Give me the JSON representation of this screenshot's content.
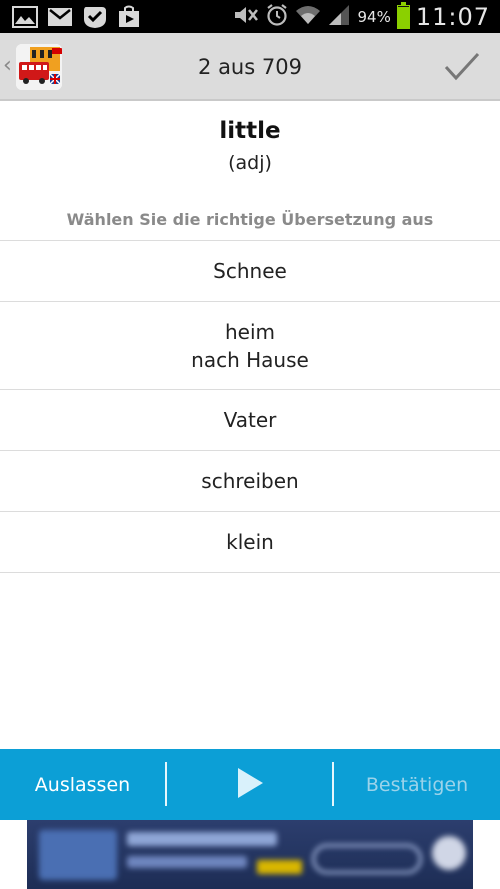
{
  "status_bar": {
    "battery_percent": "94%",
    "battery_level": 0.94,
    "time": "11:07",
    "icons": [
      "gallery-icon",
      "gmail-icon",
      "check-notification-icon",
      "play-store-icon",
      "mute-icon",
      "alarm-icon",
      "wifi-icon",
      "signal-icon",
      "battery-icon"
    ]
  },
  "action_bar": {
    "title": "2 aus 709",
    "back_icon": "chevron-left-icon",
    "app_icon": "london-bus-app-icon",
    "confirm_icon": "checkmark-icon"
  },
  "question": {
    "word": "little",
    "part_of_speech": "(adj)",
    "instruction": "Wählen Sie die richtige Übersetzung aus"
  },
  "options": [
    {
      "lines": [
        "Schnee"
      ]
    },
    {
      "lines": [
        "heim",
        "nach Hause"
      ]
    },
    {
      "lines": [
        "Vater"
      ]
    },
    {
      "lines": [
        "schreiben"
      ]
    },
    {
      "lines": [
        "klein"
      ]
    }
  ],
  "bottom_bar": {
    "skip_label": "Auslassen",
    "play_icon": "play-icon",
    "confirm_label": "Bestätigen",
    "background": "#0c9fd6"
  },
  "colors": {
    "action_bar_bg": "#dcdcdc",
    "accent": "#0c9fd6",
    "instruction_text": "#8a8a8a"
  }
}
